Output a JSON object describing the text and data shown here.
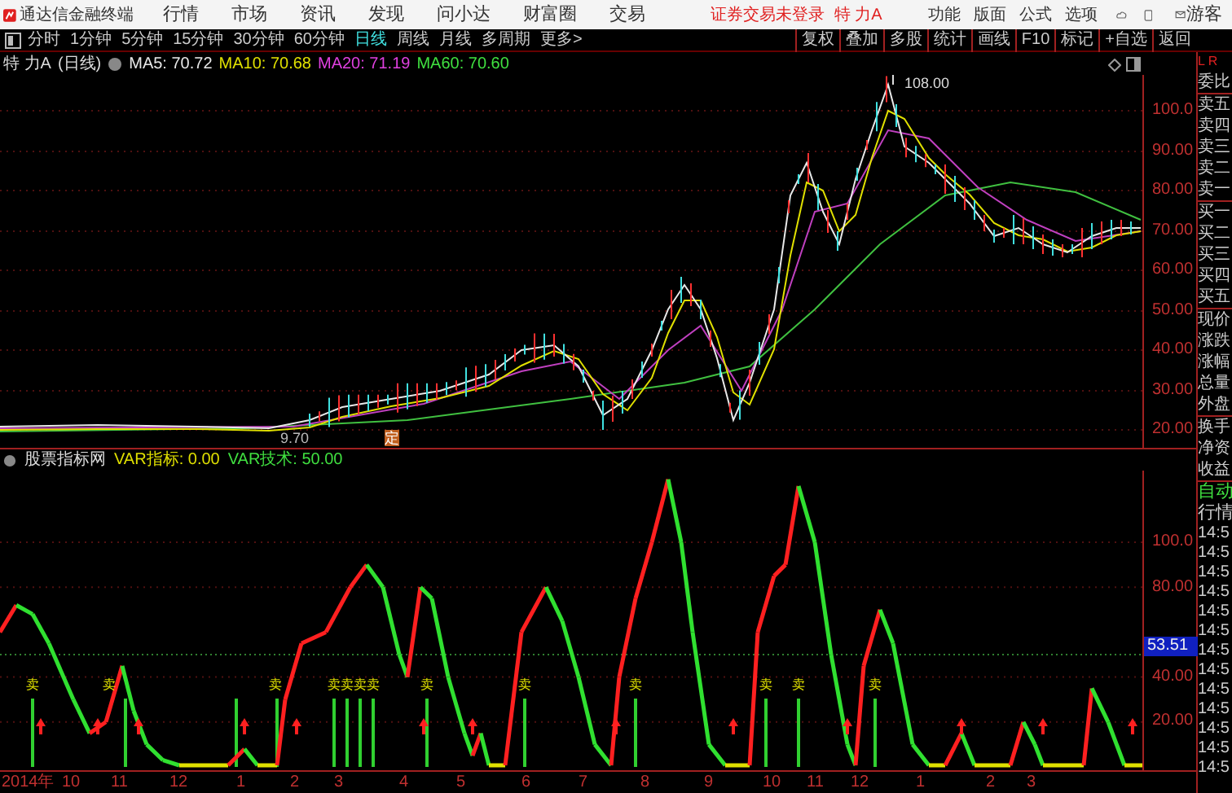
{
  "app_bar": {
    "app_name": "通达信金融终端",
    "menu": [
      "行情",
      "市场",
      "资讯",
      "发现",
      "问小达",
      "财富圈",
      "交易"
    ],
    "login_status": "证券交易未登录",
    "stock": "特 力A",
    "right_menu": [
      "功能",
      "版面",
      "公式",
      "选项"
    ],
    "user": "游客"
  },
  "period_tabs": [
    {
      "label": "分时",
      "selected": false
    },
    {
      "label": "1分钟",
      "selected": false
    },
    {
      "label": "5分钟",
      "selected": false
    },
    {
      "label": "15分钟",
      "selected": false
    },
    {
      "label": "30分钟",
      "selected": false
    },
    {
      "label": "60分钟",
      "selected": false
    },
    {
      "label": "日线",
      "selected": true
    },
    {
      "label": "周线",
      "selected": false
    },
    {
      "label": "月线",
      "selected": false
    },
    {
      "label": "多周期",
      "selected": false
    },
    {
      "label": "更多>",
      "selected": false
    }
  ],
  "tools": [
    "复权",
    "叠加",
    "多股",
    "统计",
    "画线",
    "F10",
    "标记",
    "+自选",
    "返回"
  ],
  "chart_header": {
    "title": "特 力A",
    "period": "(日线)",
    "ma": [
      {
        "label": "MA5: 70.72",
        "color": "#e8e8e8"
      },
      {
        "label": "MA10: 70.68",
        "color": "#e0e000"
      },
      {
        "label": "MA20: 71.19",
        "color": "#e040e0"
      },
      {
        "label": "MA60: 70.60",
        "color": "#40e040"
      }
    ]
  },
  "price_axis": [
    "100.0",
    "90.00",
    "80.00",
    "70.00",
    "60.00",
    "50.00",
    "40.00",
    "30.00",
    "20.00"
  ],
  "price_marks": {
    "high": "108.00",
    "low": "9.70",
    "event": "定"
  },
  "indicator_header": {
    "name": "股票指标网",
    "values": [
      {
        "label": "VAR指标: 0.00",
        "color": "#e0e000"
      },
      {
        "label": "VAR技术: 50.00",
        "color": "#40e040"
      }
    ]
  },
  "indicator_axis": [
    "100.0",
    "80.00",
    "40.00",
    "20.00"
  ],
  "cursor_value": "53.51",
  "sell_signals": [
    "卖",
    "卖",
    "卖",
    "卖",
    "卖",
    "卖",
    "卖",
    "卖",
    "卖",
    "卖",
    "卖",
    "卖",
    "卖"
  ],
  "date_axis": [
    "2014年",
    "10",
    "11",
    "12",
    "1",
    "2",
    "3",
    "4",
    "5",
    "6",
    "7",
    "8",
    "9",
    "10",
    "11",
    "12",
    "1",
    "2",
    "3"
  ],
  "quote_panel": {
    "corner": "L R",
    "rows": [
      "委比",
      "卖五",
      "卖四",
      "卖三",
      "卖二",
      "卖一",
      "买一",
      "买二",
      "买三",
      "买四",
      "买五",
      "现价",
      "涨跌",
      "涨幅",
      "总量",
      "外盘",
      "换手",
      "净资",
      "收益"
    ],
    "auto": "自动",
    "market": "行情",
    "times": [
      "14:5",
      "14:5",
      "14:5",
      "14:5",
      "14:5",
      "14:5",
      "14:5",
      "14:5",
      "14:5",
      "14:5",
      "14:5",
      "14:5",
      "14:5"
    ]
  }
}
